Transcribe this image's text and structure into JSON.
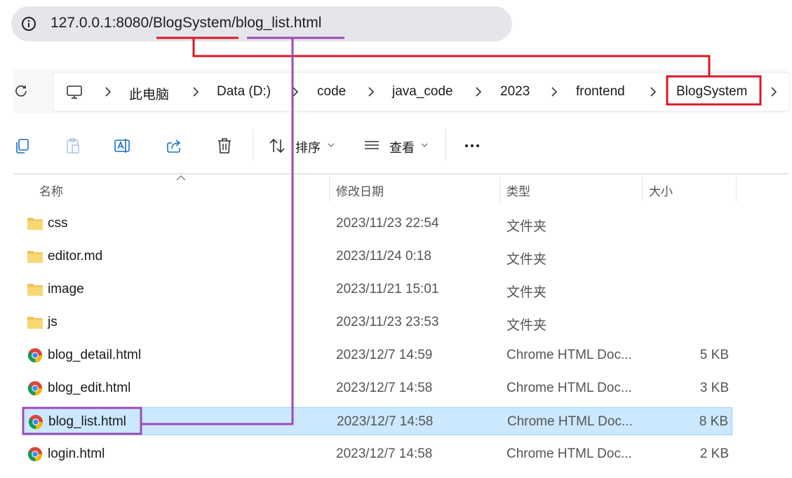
{
  "browser": {
    "url_host": "127.0.0.1:8080/",
    "url_project": "BlogSystem",
    "url_slash": "/",
    "url_file": "blog_list.html"
  },
  "breadcrumb": {
    "items": [
      "此电脑",
      "Data (D:)",
      "code",
      "java_code",
      "2023",
      "frontend",
      "BlogSystem"
    ]
  },
  "toolbar": {
    "sort_label": "排序",
    "view_label": "查看"
  },
  "columns": {
    "name": "名称",
    "date": "修改日期",
    "type": "类型",
    "size": "大小"
  },
  "files": [
    {
      "name": "css",
      "date": "2023/11/23 22:54",
      "type": "文件夹",
      "size": "",
      "kind": "folder"
    },
    {
      "name": "editor.md",
      "date": "2023/11/24 0:18",
      "type": "文件夹",
      "size": "",
      "kind": "folder"
    },
    {
      "name": "image",
      "date": "2023/11/21 15:01",
      "type": "文件夹",
      "size": "",
      "kind": "folder"
    },
    {
      "name": "js",
      "date": "2023/11/23 23:53",
      "type": "文件夹",
      "size": "",
      "kind": "folder"
    },
    {
      "name": "blog_detail.html",
      "date": "2023/12/7 14:59",
      "type": "Chrome HTML Doc...",
      "size": "5 KB",
      "kind": "chrome-html"
    },
    {
      "name": "blog_edit.html",
      "date": "2023/12/7 14:58",
      "type": "Chrome HTML Doc...",
      "size": "3 KB",
      "kind": "chrome-html"
    },
    {
      "name": "blog_list.html",
      "date": "2023/12/7 14:58",
      "type": "Chrome HTML Doc...",
      "size": "8 KB",
      "kind": "chrome-html",
      "selected": true
    },
    {
      "name": "login.html",
      "date": "2023/12/7 14:58",
      "type": "Chrome HTML Doc...",
      "size": "2 KB",
      "kind": "chrome-html"
    }
  ],
  "colors": {
    "annotation_red": "#d9182a",
    "annotation_purple": "#9b4db5",
    "selection_bg": "#cce8ff",
    "folder": "#f2c14e"
  },
  "icons": {
    "address_bar": "info-icon",
    "refresh": "refresh-icon",
    "this_pc": "computer-icon",
    "folder": "folder-icon",
    "chrome_html": "chrome-icon"
  }
}
